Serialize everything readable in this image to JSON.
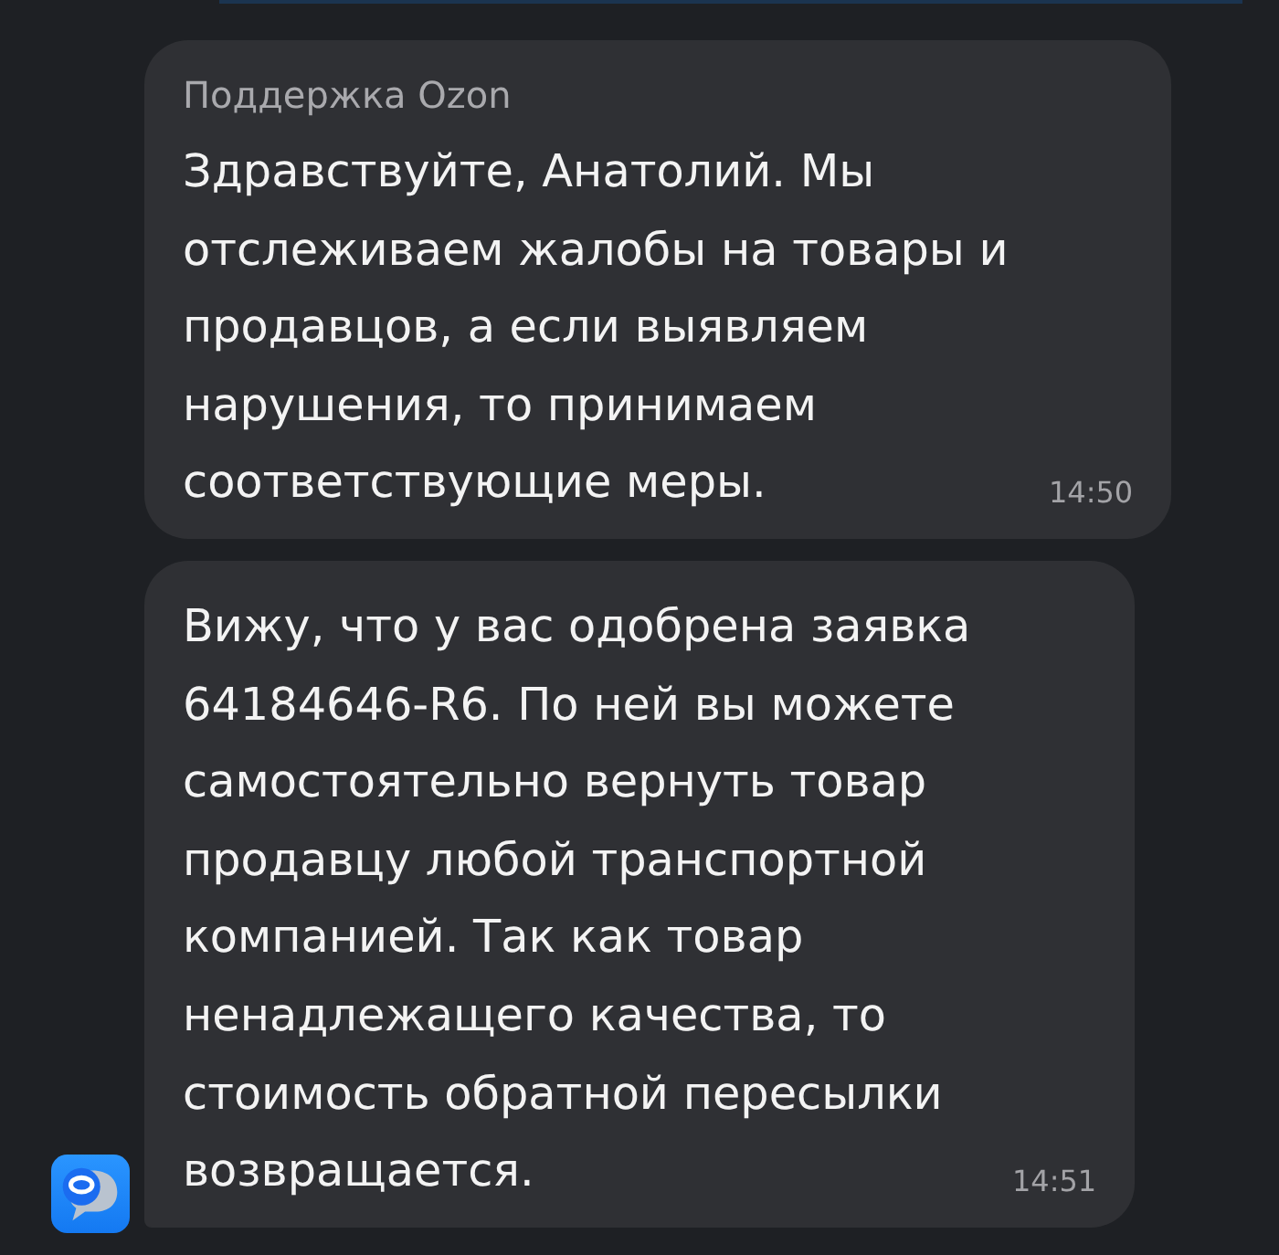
{
  "messages": [
    {
      "sender": "Поддержка Ozon",
      "text": "Здравствуйте, Анатолий. Мы отслеживаем жалобы на товары и продавцов, а если выявляем нарушения, то принимаем соответствующие меры.",
      "time": "14:50",
      "show_avatar": false
    },
    {
      "text": "Вижу, что у вас одобрена заявка 64184646-R6. По ней вы можете самостоятельно вернуть товар продавцу любой транспортной компанией. Так как товар ненадлежащего качества, то стоимость обратной пересылки возвращается.",
      "time": "14:51",
      "show_avatar": true
    }
  ]
}
